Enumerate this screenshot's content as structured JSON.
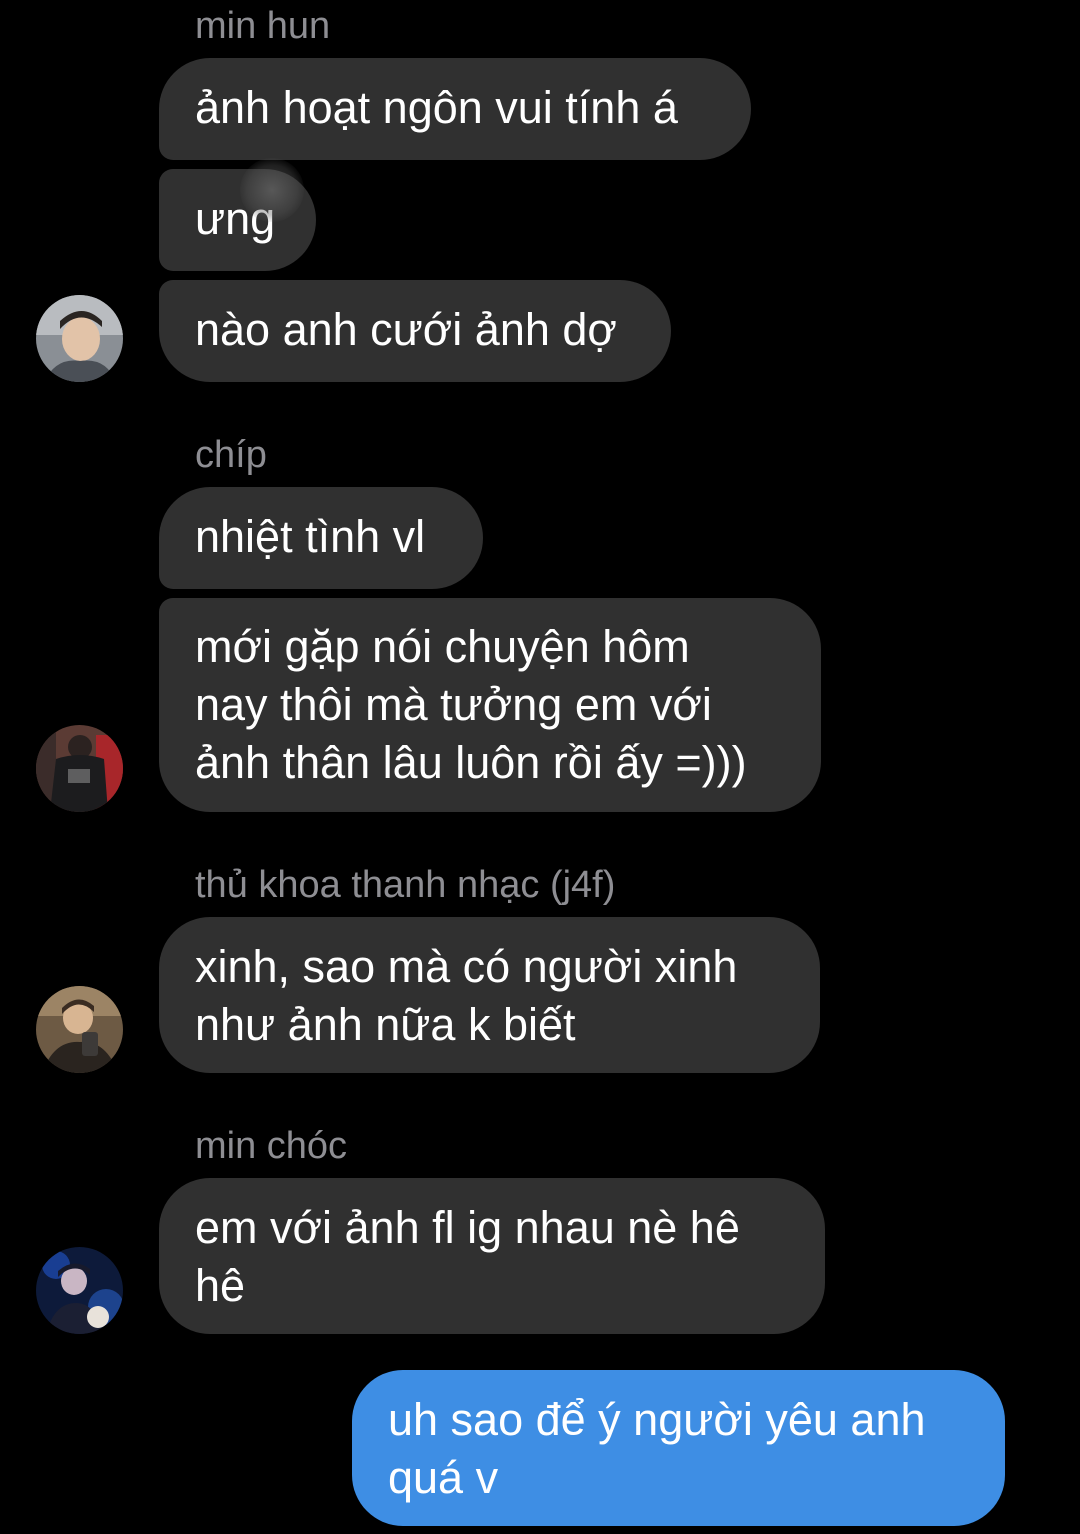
{
  "conversation": {
    "groups": [
      {
        "sender": "min hun",
        "avatar": "avatar-photo-min-hun",
        "messages": [
          {
            "lines": [
              "ảnh hoạt ngôn vui tính á"
            ]
          },
          {
            "lines": [
              "ưng"
            ]
          },
          {
            "lines": [
              "nào anh cưới ảnh dợ"
            ]
          }
        ]
      },
      {
        "sender": "chíp",
        "avatar": "avatar-photo-chip",
        "messages": [
          {
            "lines": [
              "nhiệt tình vl"
            ]
          },
          {
            "lines": [
              "mới gặp nói chuyện hôm",
              "nay thôi mà tưởng em với",
              "ảnh thân lâu luôn rồi ấy =)))"
            ]
          }
        ]
      },
      {
        "sender": "thủ khoa thanh nhạc (j4f)",
        "avatar": "avatar-photo-thu-khoa-thanh-nhac",
        "messages": [
          {
            "lines": [
              "xinh, sao mà có người xinh",
              "như ảnh nữa k biết"
            ]
          }
        ]
      },
      {
        "sender": "min chóc",
        "avatar": "avatar-photo-min-choc",
        "messages": [
          {
            "lines": [
              "em với ảnh fl ig nhau nè hê",
              "hê"
            ]
          }
        ]
      }
    ],
    "outgoing": {
      "lines": [
        "uh sao để ý người yêu anh",
        "quá v"
      ]
    }
  },
  "colors": {
    "background": "#000000",
    "incoming_bubble": "#303030",
    "outgoing_bubble": "#3e8ee4",
    "sender_name": "#8e8e93",
    "text": "#ffffff"
  }
}
